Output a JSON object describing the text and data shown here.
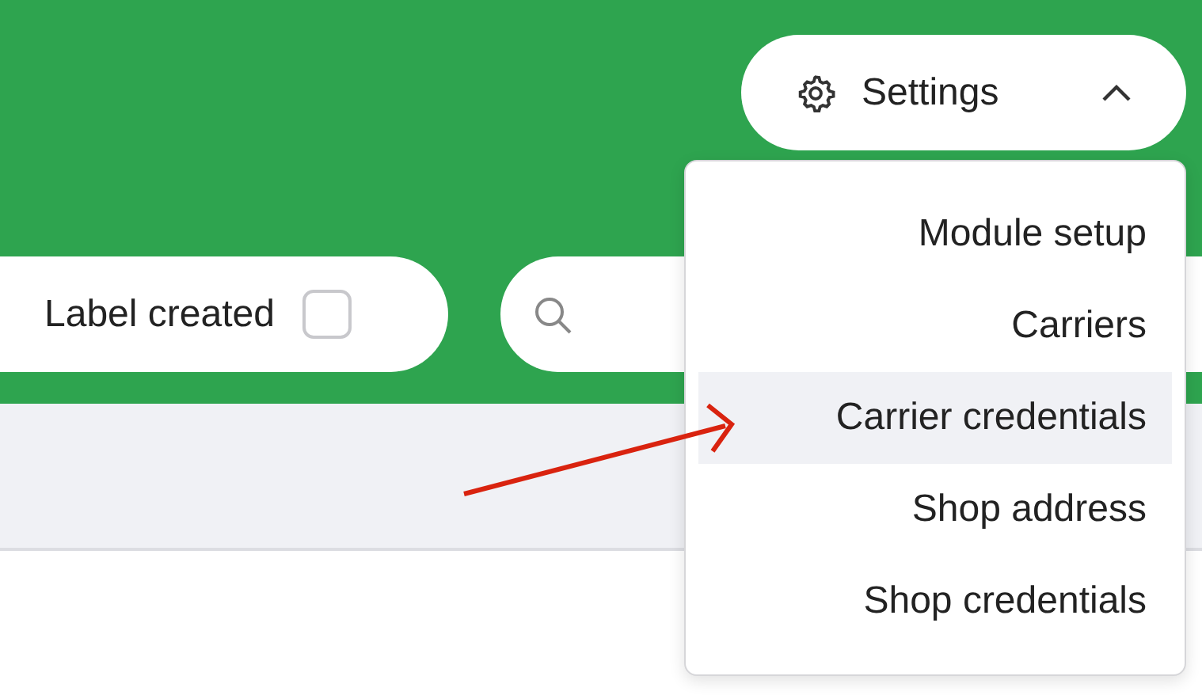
{
  "settings_button": {
    "label": "Settings",
    "expanded": true
  },
  "filters": [
    {
      "label": "Label created",
      "checked": false
    }
  ],
  "settings_menu": {
    "items": [
      {
        "label": "Module setup",
        "selected": false
      },
      {
        "label": "Carriers",
        "selected": false
      },
      {
        "label": "Carrier credentials",
        "selected": true
      },
      {
        "label": "Shop address",
        "selected": false
      },
      {
        "label": "Shop credentials",
        "selected": false
      }
    ]
  }
}
